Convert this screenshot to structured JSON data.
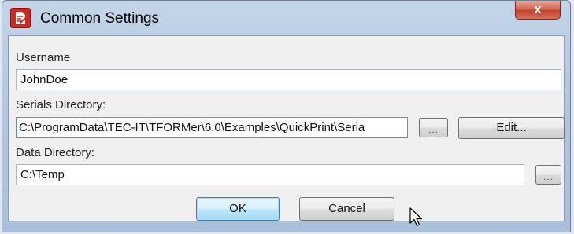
{
  "window": {
    "title": "Common Settings",
    "close_label": "x"
  },
  "username": {
    "label": "Username",
    "value": "JohnDoe"
  },
  "serials": {
    "label": "Serials Directory:",
    "value": "C:\\ProgramData\\TEC-IT\\TFORMer\\6.0\\Examples\\QuickPrint\\Seria",
    "browse_label": "...",
    "edit_label": "Edit..."
  },
  "data_dir": {
    "label": "Data Directory:",
    "value": "C:\\Temp",
    "browse_label": "..."
  },
  "footer": {
    "ok_label": "OK",
    "cancel_label": "Cancel"
  },
  "colors": {
    "app_icon": "#d7261e",
    "close_button": "#c4432e",
    "default_button_border": "#3c7fb1"
  }
}
